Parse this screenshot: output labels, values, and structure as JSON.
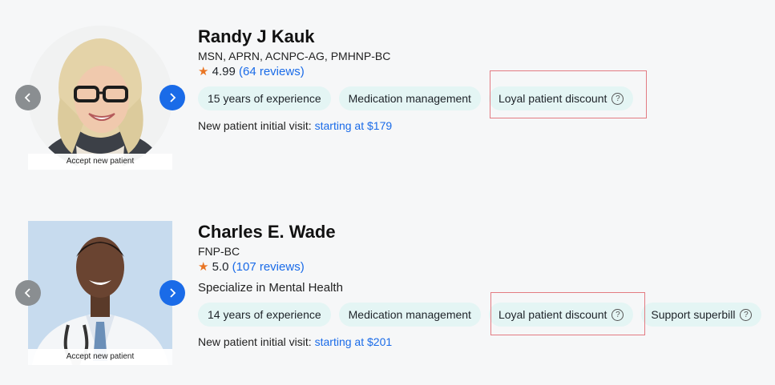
{
  "providers": [
    {
      "name": "Randy J Kauk",
      "credentials": "MSN, APRN, ACNPC-AG, PMHNP-BC",
      "rating": "4.99",
      "reviews": "(64 reviews)",
      "accept_label": "Accept new patient",
      "tags": [
        "15 years of experience",
        "Medication management",
        "Loyal patient discount"
      ],
      "visit_label": "New patient initial visit:",
      "visit_price": "starting at $179"
    },
    {
      "name": "Charles E. Wade",
      "credentials": "FNP-BC",
      "rating": "5.0",
      "reviews": "(107 reviews)",
      "specialty": "Specialize in Mental Health",
      "accept_label": "Accept new patient",
      "tags": [
        "14 years of experience",
        "Medication management",
        "Loyal patient discount",
        "Support superbill"
      ],
      "visit_label": "New patient initial visit:",
      "visit_price": "starting at $201"
    }
  ],
  "colors": {
    "accent": "#1a6be8",
    "star": "#e97524",
    "tag_bg": "#e4f5f4",
    "highlight": "#e37b82"
  }
}
